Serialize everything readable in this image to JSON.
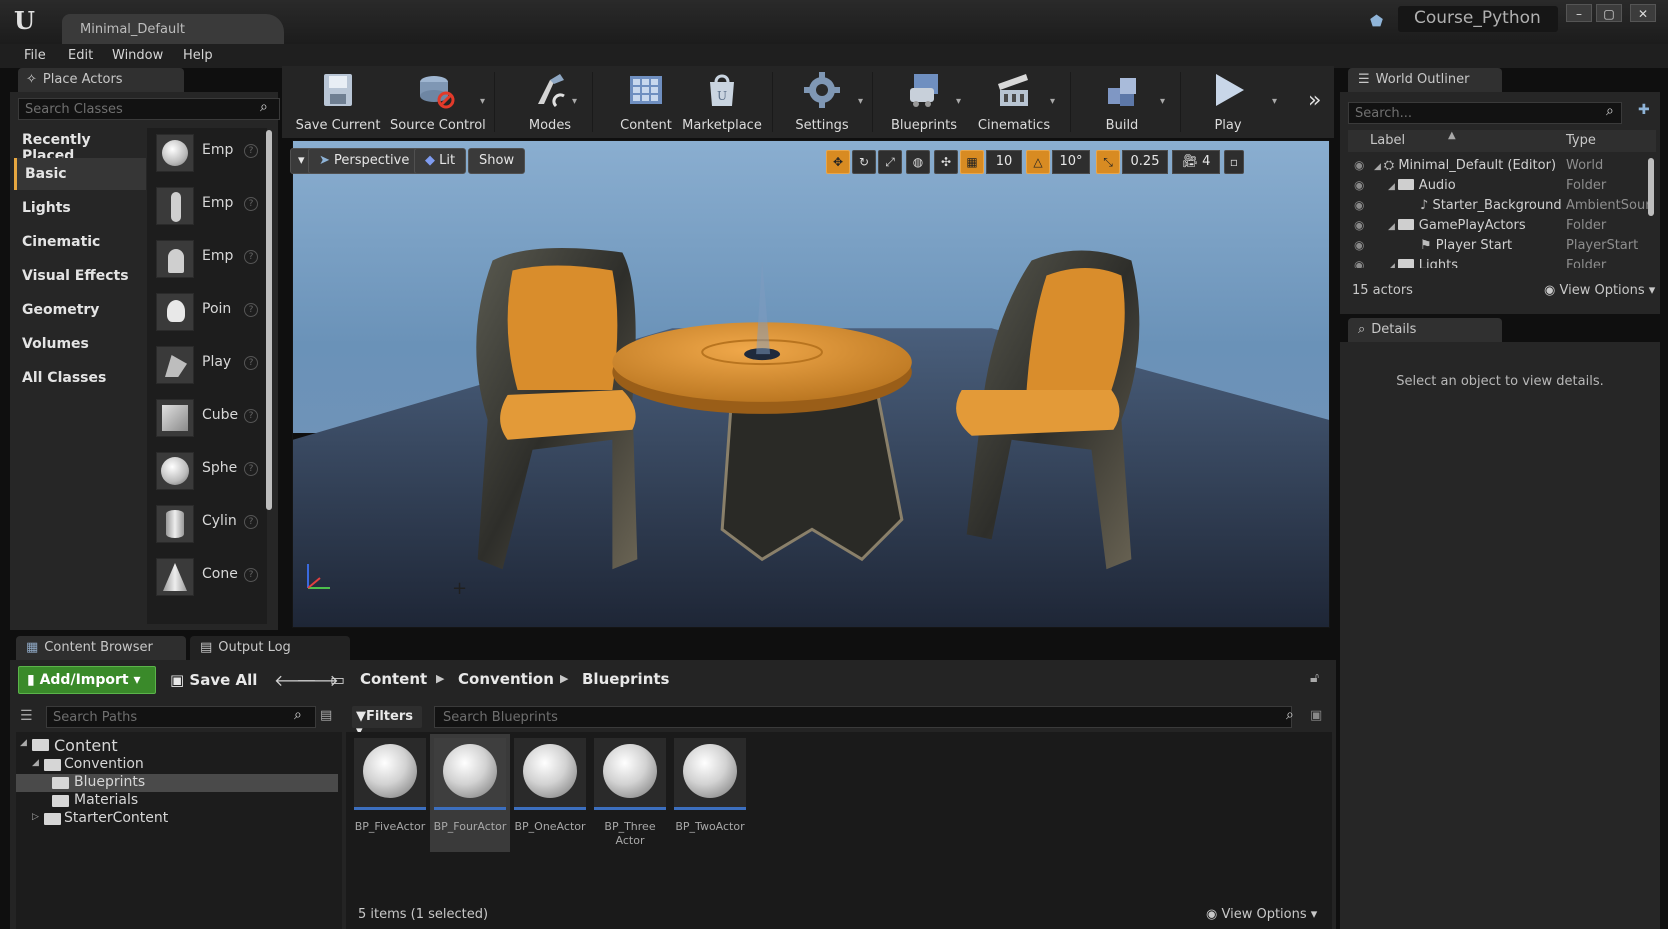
{
  "window": {
    "logo": "U",
    "doc_tab": "Minimal_Default",
    "project": "Course_Python",
    "controls": [
      "–",
      "▢",
      "✕"
    ]
  },
  "menu": [
    "File",
    "Edit",
    "Window",
    "Help"
  ],
  "place_actors": {
    "tab": "Place Actors",
    "search_placeholder": "Search Classes",
    "categories": [
      "Recently Placed",
      "Basic",
      "Lights",
      "Cinematic",
      "Visual Effects",
      "Geometry",
      "Volumes",
      "All Classes"
    ],
    "active_category": "Basic",
    "items": [
      {
        "label": "Emp",
        "icon": "empty-actor-icon"
      },
      {
        "label": "Emp",
        "icon": "empty-character-icon"
      },
      {
        "label": "Emp",
        "icon": "empty-pawn-icon"
      },
      {
        "label": "Poin",
        "icon": "point-light-icon"
      },
      {
        "label": "Play",
        "icon": "player-start-icon"
      },
      {
        "label": "Cube",
        "icon": "cube-icon"
      },
      {
        "label": "Sphe",
        "icon": "sphere-icon"
      },
      {
        "label": "Cylin",
        "icon": "cylinder-icon"
      },
      {
        "label": "Cone",
        "icon": "cone-icon"
      }
    ]
  },
  "toolbar": {
    "items": [
      {
        "label": "Save Current",
        "icon": "save-icon"
      },
      {
        "label": "Source Control",
        "icon": "source-control-icon"
      },
      {
        "label": "Modes",
        "icon": "modes-icon"
      },
      {
        "label": "Content",
        "icon": "content-icon"
      },
      {
        "label": "Marketplace",
        "icon": "marketplace-icon"
      },
      {
        "label": "Settings",
        "icon": "settings-icon"
      },
      {
        "label": "Blueprints",
        "icon": "blueprints-icon"
      },
      {
        "label": "Cinematics",
        "icon": "cinematics-icon"
      },
      {
        "label": "Build",
        "icon": "build-icon"
      },
      {
        "label": "Play",
        "icon": "play-icon"
      }
    ]
  },
  "viewport": {
    "view_mode": "Perspective",
    "lighting": "Lit",
    "show": "Show",
    "grid_snap": "10",
    "rotation_snap": "10°",
    "scale_snap": "0.25",
    "camera_speed": "4"
  },
  "world_outliner": {
    "tab": "World Outliner",
    "search_placeholder": "Search...",
    "col_label": "Label",
    "col_type": "Type",
    "rows": [
      {
        "label": "Minimal_Default (Editor)",
        "type": "World",
        "indent": 0
      },
      {
        "label": "Audio",
        "type": "Folder",
        "indent": 1
      },
      {
        "label": "Starter_Background",
        "type": "AmbientSour",
        "indent": 2
      },
      {
        "label": "GamePlayActors",
        "type": "Folder",
        "indent": 1
      },
      {
        "label": "Player Start",
        "type": "PlayerStart",
        "indent": 2
      },
      {
        "label": "Lights",
        "type": "Folder",
        "indent": 1
      }
    ],
    "actor_count": "15 actors",
    "view_options": "View Options"
  },
  "details": {
    "tab": "Details",
    "empty_message": "Select an object to view details."
  },
  "content_browser": {
    "tabs": [
      "Content Browser",
      "Output Log"
    ],
    "add_import": "Add/Import",
    "save_all": "Save All",
    "breadcrumb": [
      "Content",
      "Convention",
      "Blueprints"
    ],
    "paths_placeholder": "Search Paths",
    "filters": "Filters",
    "search_placeholder": "Search Blueprints",
    "tree": [
      {
        "label": "Content",
        "indent": 0,
        "expanded": true,
        "selected": false
      },
      {
        "label": "Convention",
        "indent": 1,
        "expanded": true,
        "selected": false
      },
      {
        "label": "Blueprints",
        "indent": 2,
        "expanded": false,
        "selected": true
      },
      {
        "label": "Materials",
        "indent": 2,
        "expanded": false,
        "selected": false
      },
      {
        "label": "StarterContent",
        "indent": 1,
        "expanded": false,
        "selected": false
      }
    ],
    "assets": [
      {
        "label": "BP_FiveActor",
        "selected": false
      },
      {
        "label": "BP_FourActor",
        "selected": true
      },
      {
        "label": "BP_OneActor",
        "selected": false
      },
      {
        "label": "BP_Three Actor",
        "selected": false
      },
      {
        "label": "BP_TwoActor",
        "selected": false
      }
    ],
    "status": "5 items (1 selected)",
    "view_options": "View Options"
  }
}
